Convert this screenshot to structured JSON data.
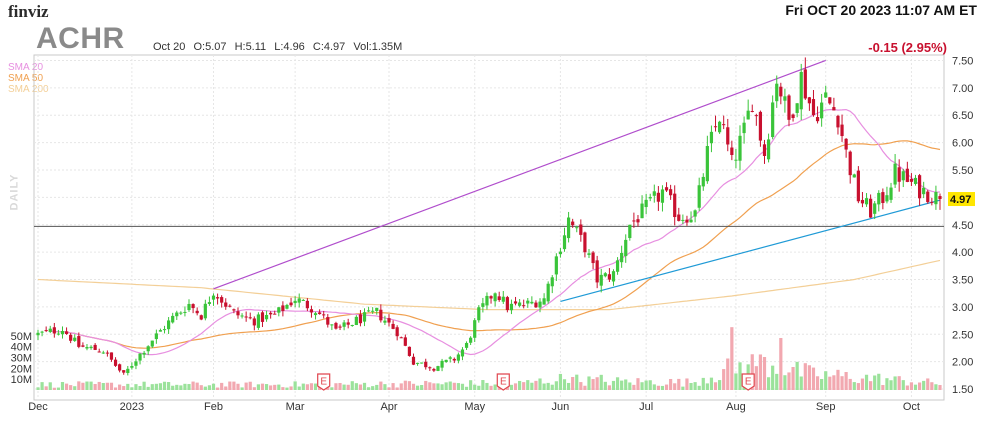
{
  "header": {
    "logo": "finviz",
    "datetime": "Fri OCT 20 2023 11:07 AM ET",
    "ticker": "ACHR",
    "date": "Oct 20",
    "open": "O:5.07",
    "high": "H:5.11",
    "low": "L:4.96",
    "close": "C:4.97",
    "volume": "Vol:1.35M",
    "change": "-0.15 (2.95%)"
  },
  "legend": {
    "sma20": "SMA 20",
    "sma50": "SMA 50",
    "sma200": "SMA 200",
    "timeframe": "DAILY"
  },
  "colors": {
    "up": "#3ac43a",
    "down": "#c8102e",
    "sma20": "#e78fe0",
    "sma50": "#f0a050",
    "sma200": "#f3cf97",
    "upper_trend": "#b04dcc",
    "lower_trend": "#1f9ad6",
    "support": "#555555",
    "price_label_bg": "#ffe600",
    "earnings": "#e0464f"
  },
  "chart_data": {
    "type": "candlestick",
    "price_axis": {
      "ticks": [
        "7.50",
        "7.00",
        "6.50",
        "6.00",
        "5.50",
        "5.00",
        "4.50",
        "4.00",
        "3.50",
        "3.00",
        "2.50",
        "2.00",
        "1.50"
      ],
      "ylim": [
        1.3,
        7.6
      ]
    },
    "volume_axis": {
      "ticks": [
        "50M",
        "40M",
        "30M",
        "20M",
        "10M"
      ],
      "max": 60
    },
    "x_axis": {
      "labels": [
        "Dec",
        "2023",
        "Feb",
        "Mar",
        "Apr",
        "May",
        "Jun",
        "Jul",
        "Aug",
        "Sep",
        "Oct"
      ],
      "label_days": [
        0,
        23,
        43,
        63,
        86,
        107,
        128,
        149,
        171,
        193,
        214
      ]
    },
    "last_price": "4.97",
    "earnings_marker": "E",
    "earnings_days": [
      70,
      114,
      174
    ],
    "support_level": 4.47,
    "trendlines": {
      "upper": [
        [
          43,
          3.33
        ],
        [
          193,
          7.5
        ]
      ],
      "lower": [
        [
          128,
          3.1
        ],
        [
          221,
          4.95
        ]
      ]
    },
    "anchors": [
      [
        0,
        2.5
      ],
      [
        6,
        2.6
      ],
      [
        10,
        2.28
      ],
      [
        16,
        2.2
      ],
      [
        21,
        1.75
      ],
      [
        24,
        2.05
      ],
      [
        28,
        2.4
      ],
      [
        33,
        2.8
      ],
      [
        37,
        3.05
      ],
      [
        40,
        2.85
      ],
      [
        43,
        3.3
      ],
      [
        48,
        2.88
      ],
      [
        53,
        2.75
      ],
      [
        58,
        2.85
      ],
      [
        63,
        3.15
      ],
      [
        68,
        2.95
      ],
      [
        73,
        2.55
      ],
      [
        78,
        2.75
      ],
      [
        83,
        2.9
      ],
      [
        88,
        2.55
      ],
      [
        92,
        2.0
      ],
      [
        97,
        1.9
      ],
      [
        102,
        2.05
      ],
      [
        105,
        2.3
      ],
      [
        108,
        2.9
      ],
      [
        112,
        3.3
      ],
      [
        115,
        3.0
      ],
      [
        120,
        3.05
      ],
      [
        124,
        3.15
      ],
      [
        127,
        3.9
      ],
      [
        130,
        4.6
      ],
      [
        134,
        4.1
      ],
      [
        137,
        3.5
      ],
      [
        141,
        3.6
      ],
      [
        145,
        4.5
      ],
      [
        149,
        4.8
      ],
      [
        153,
        5.1
      ],
      [
        157,
        4.65
      ],
      [
        161,
        4.7
      ],
      [
        164,
        5.8
      ],
      [
        167,
        6.5
      ],
      [
        170,
        5.6
      ],
      [
        173,
        6.2
      ],
      [
        175,
        6.8
      ],
      [
        178,
        5.8
      ],
      [
        181,
        7.2
      ],
      [
        184,
        6.4
      ],
      [
        187,
        7.2
      ],
      [
        190,
        6.5
      ],
      [
        193,
        6.8
      ],
      [
        196,
        6.5
      ],
      [
        198,
        5.8
      ],
      [
        201,
        5.0
      ],
      [
        204,
        4.75
      ],
      [
        207,
        5.0
      ],
      [
        210,
        5.45
      ],
      [
        213,
        5.3
      ],
      [
        216,
        5.15
      ],
      [
        219,
        5.05
      ],
      [
        221,
        4.97
      ]
    ],
    "sma200_points": [
      [
        0,
        3.5
      ],
      [
        40,
        3.35
      ],
      [
        80,
        3.05
      ],
      [
        110,
        2.95
      ],
      [
        140,
        2.95
      ],
      [
        170,
        3.2
      ],
      [
        200,
        3.5
      ],
      [
        221,
        3.85
      ]
    ],
    "volume_profile": [
      [
        0,
        5
      ],
      [
        60,
        5
      ],
      [
        100,
        6
      ],
      [
        118,
        6
      ],
      [
        128,
        10
      ],
      [
        140,
        8
      ],
      [
        160,
        7
      ],
      [
        170,
        20
      ],
      [
        178,
        25
      ],
      [
        190,
        14
      ],
      [
        200,
        12
      ],
      [
        221,
        6
      ]
    ],
    "volume_spikes": [
      [
        170,
        58
      ],
      [
        182,
        48
      ],
      [
        186,
        26
      ],
      [
        176,
        22
      ],
      [
        138,
        14
      ],
      [
        131,
        12
      ]
    ],
    "days": 222
  }
}
